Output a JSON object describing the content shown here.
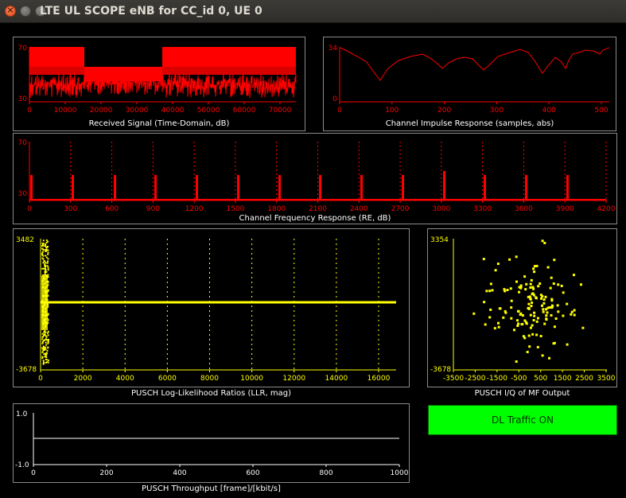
{
  "window": {
    "title": "LTE UL SCOPE eNB for CC_id 0, UE 0",
    "close_glyph": "×"
  },
  "colors": {
    "red": "#ff0000",
    "yellow": "#ffff00",
    "white": "#ffffff",
    "green": "#00ff00",
    "border": "#8a8a8a",
    "background": "#000000"
  },
  "plots": {
    "received_signal": {
      "label": "Received Signal (Time-Domain, dB)",
      "y_ticks": [
        "70",
        "30"
      ],
      "x_ticks": [
        "0",
        "10000",
        "20000",
        "30000",
        "40000",
        "50000",
        "60000",
        "70000"
      ]
    },
    "channel_impulse": {
      "label": "Channel Impulse Response (samples, abs)",
      "y_ticks": [
        "34",
        "0"
      ],
      "x_ticks": [
        "0",
        "100",
        "200",
        "300",
        "400",
        "500"
      ]
    },
    "channel_frequency": {
      "label": "Channel Frequency  Response (RE, dB)",
      "y_ticks": [
        "70",
        "30"
      ],
      "x_ticks": [
        "0",
        "300",
        "600",
        "900",
        "1200",
        "1500",
        "1800",
        "2100",
        "2400",
        "2700",
        "3000",
        "3300",
        "3600",
        "3900",
        "4200"
      ]
    },
    "pusch_llr": {
      "label": "PUSCH Log-Likelihood Ratios (LLR, mag)",
      "y_ticks": [
        "3482",
        "-3678"
      ],
      "x_ticks": [
        "0",
        "2000",
        "4000",
        "6000",
        "8000",
        "10000",
        "12000",
        "14000",
        "16000"
      ]
    },
    "pusch_iq": {
      "label": "PUSCH I/Q of MF Output",
      "y_ticks": [
        "3354",
        "-3678"
      ],
      "x_ticks": [
        "-3500",
        "-2500",
        "-1500",
        "-500",
        "500",
        "1500",
        "2500",
        "3500"
      ]
    },
    "pusch_throughput": {
      "label": "PUSCH Throughput [frame]/[kbit/s]",
      "y_ticks": [
        "1.0",
        "-1.0"
      ],
      "x_ticks": [
        "0",
        "200",
        "400",
        "600",
        "800",
        "1000"
      ]
    }
  },
  "traffic_button": {
    "label": "DL Traffic ON"
  }
}
